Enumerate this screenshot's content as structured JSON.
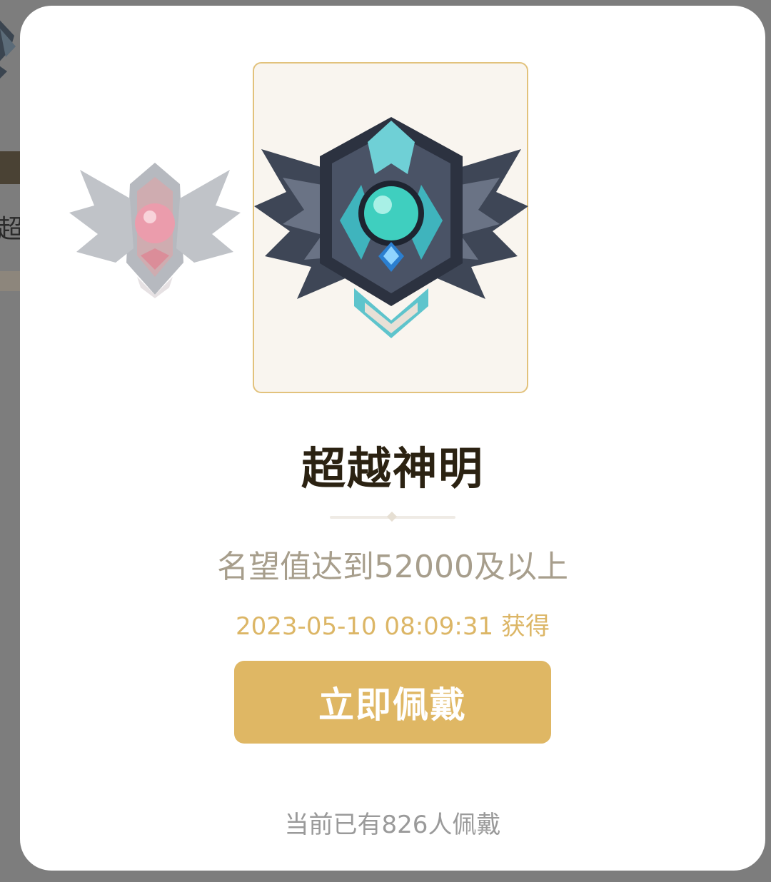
{
  "background": {
    "partial_text": "超"
  },
  "badge": {
    "name": "超越神明",
    "description": "名望值达到52000及以上",
    "obtained_time": "2023-05-10 08:09:31 获得",
    "main_icon": "teal-winged-emblem-icon",
    "side_icon": "red-winged-emblem-icon"
  },
  "actions": {
    "wear_label": "立即佩戴"
  },
  "footer": {
    "wearers_text": "当前已有826人佩戴"
  },
  "colors": {
    "accent": "#dfb764",
    "title": "#2b2212",
    "description": "#a79e8c",
    "time": "#dcb666",
    "card_border": "#e2c27c",
    "card_bg": "#f9f5ef"
  }
}
